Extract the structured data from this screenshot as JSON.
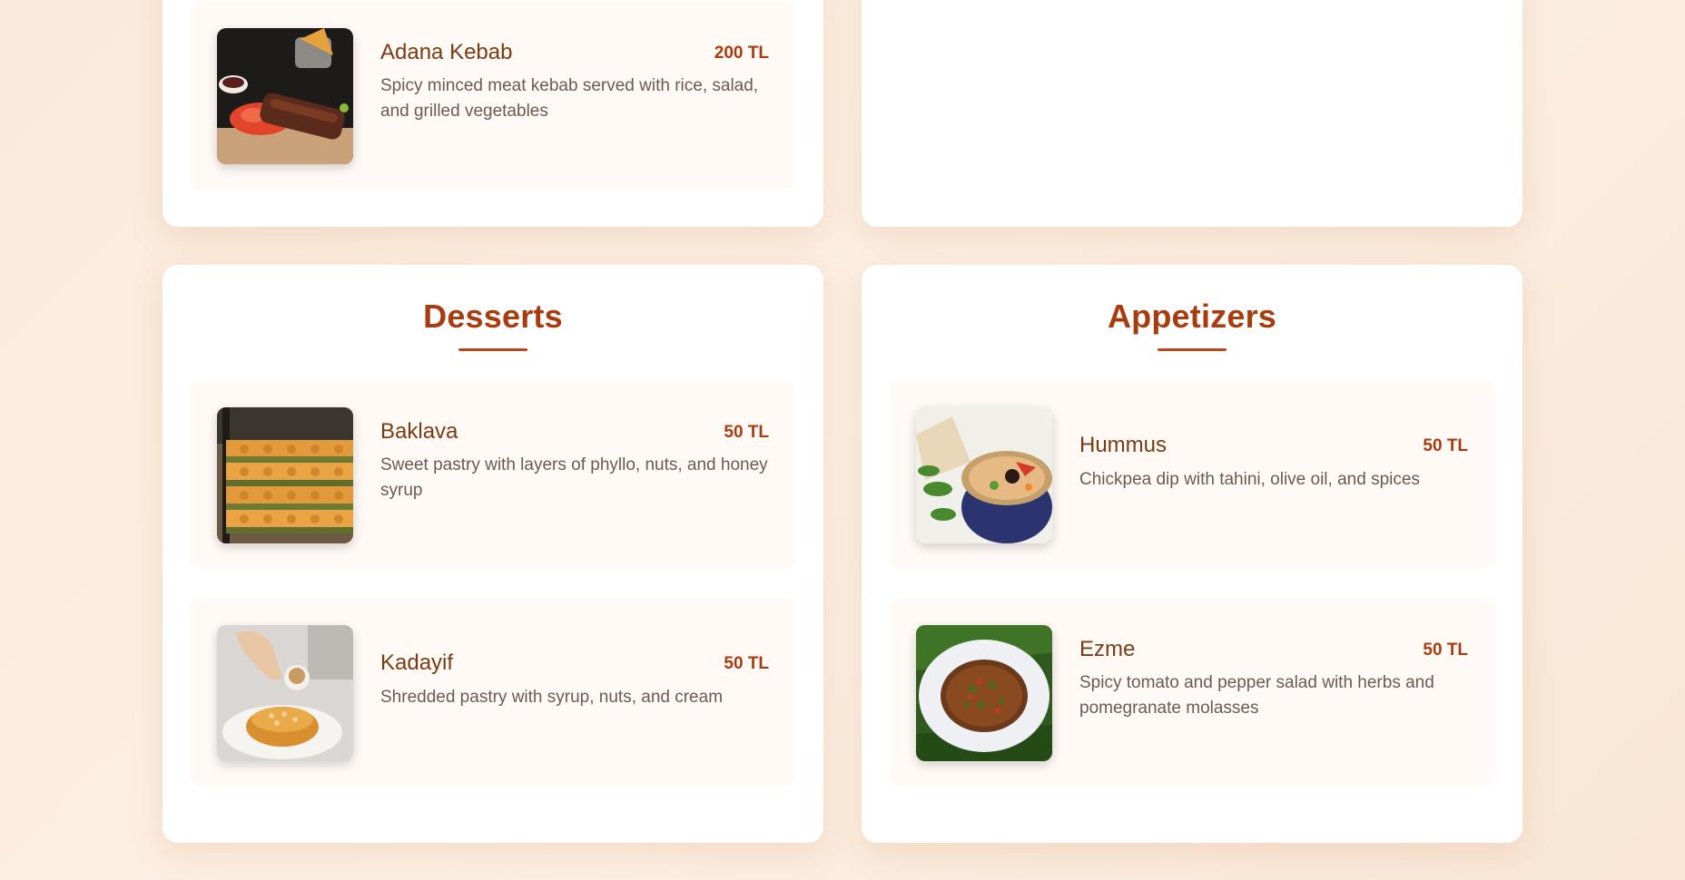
{
  "sections": {
    "mains": {
      "items": [
        {
          "name": "Adana Kebab",
          "price": "200 TL",
          "description": "Spicy minced meat kebab served with rice, salad, and grilled vegetables",
          "image": "adana-kebab-photo"
        }
      ]
    },
    "desserts": {
      "title": "Desserts",
      "items": [
        {
          "name": "Baklava",
          "price": "50 TL",
          "description": "Sweet pastry with layers of phyllo, nuts, and honey syrup",
          "image": "baklava-photo"
        },
        {
          "name": "Kadayif",
          "price": "50 TL",
          "description": "Shredded pastry with syrup, nuts, and cream",
          "image": "kadayif-photo"
        }
      ]
    },
    "appetizers": {
      "title": "Appetizers",
      "items": [
        {
          "name": "Hummus",
          "price": "50 TL",
          "description": "Chickpea dip with tahini, olive oil, and spices",
          "image": "hummus-photo"
        },
        {
          "name": "Ezme",
          "price": "50 TL",
          "description": "Spicy tomato and pepper salad with herbs and pomegranate molasses",
          "image": "ezme-photo"
        }
      ]
    }
  },
  "colors": {
    "accent": "#a93c0f",
    "item_name": "#7a3b12",
    "description": "#6a5b52",
    "page_background": "#fcefe3",
    "item_background": "#fffaf6"
  }
}
